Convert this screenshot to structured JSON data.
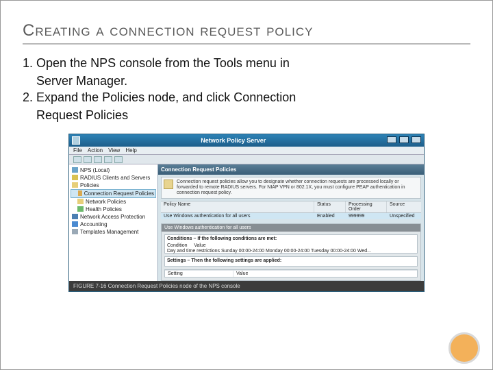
{
  "title": "Creating a connection request policy",
  "steps": [
    {
      "num": "1.",
      "line1": "Open the NPS console from the Tools menu in",
      "line2": "Server Manager."
    },
    {
      "num": "2.",
      "line1": "Expand the Policies node, and click Connection",
      "line2": "Request Policies"
    }
  ],
  "window": {
    "title": "Network Policy Server",
    "menus": [
      "File",
      "Action",
      "View",
      "Help"
    ],
    "tree": [
      {
        "icon": "i-nps",
        "label": "NPS (Local)",
        "cls": ""
      },
      {
        "icon": "i-radius",
        "label": "RADIUS Clients and Servers",
        "cls": ""
      },
      {
        "icon": "i-folder",
        "label": "Policies",
        "cls": ""
      },
      {
        "icon": "i-sel",
        "label": "Connection Request Policies",
        "cls": "lvl1 sel"
      },
      {
        "icon": "i-policy",
        "label": "Network Policies",
        "cls": "lvl1"
      },
      {
        "icon": "i-health",
        "label": "Health Policies",
        "cls": "lvl1"
      },
      {
        "icon": "i-shield",
        "label": "Network Access Protection",
        "cls": ""
      },
      {
        "icon": "i-acct",
        "label": "Accounting",
        "cls": ""
      },
      {
        "icon": "i-templ",
        "label": "Templates Management",
        "cls": ""
      }
    ],
    "panel_title": "Connection Request Policies",
    "info_text": "Connection request policies allow you to designate whether connection requests are processed locally or forwarded to remote RADIUS servers. For NIAP VPN or 802.1X, you must configure PEAP authentication in connection request policy.",
    "columns": {
      "name": "Policy Name",
      "status": "Status",
      "order": "Processing Order",
      "source": "Source"
    },
    "row": {
      "name": "Use Windows authentication for all users",
      "status": "Enabled",
      "order": "999999",
      "source": "Unspecified"
    },
    "subheader": "Use Windows authentication for all users",
    "cond_header": "Conditions – If the following conditions are met:",
    "cond_cols": {
      "c": "Condition",
      "v": "Value"
    },
    "cond_text": "Day and time restrictions   Sunday 00:00-24:00 Monday 00:00-24:00 Tuesday 00:00-24:00 Wed...",
    "settings_header": "Settings – Then the following settings are applied:",
    "settings_cols": {
      "c": "Setting",
      "v": "Value"
    }
  },
  "figure_caption": "FIGURE 7-16  Connection Request Policies node of the NPS console"
}
